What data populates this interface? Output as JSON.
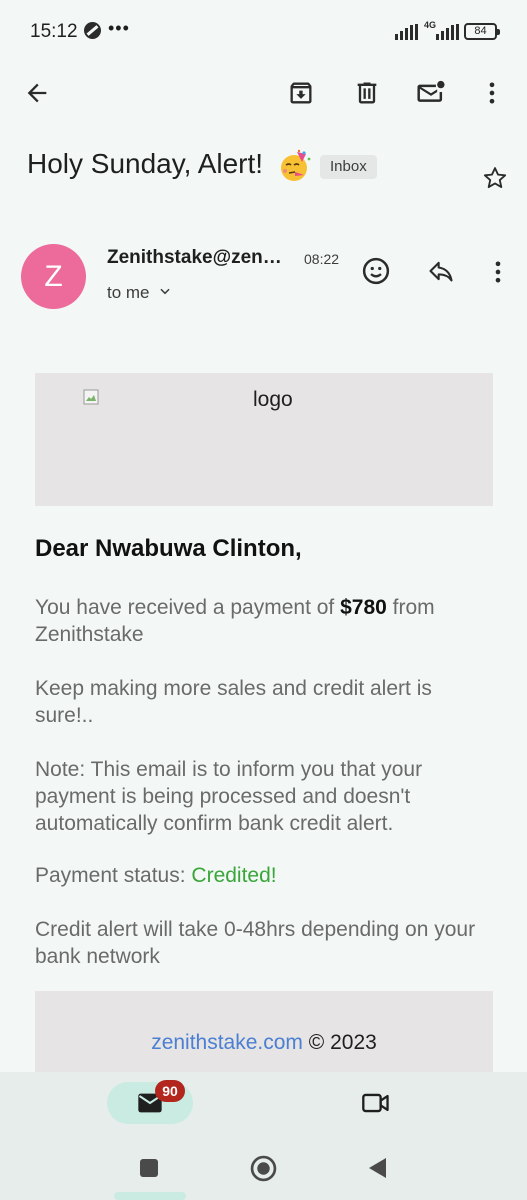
{
  "status_bar": {
    "time": "15:12",
    "more_indicator": "•••",
    "network_label": "4G",
    "battery": "84"
  },
  "toolbar": {
    "back_icon": "arrow-left-icon",
    "archive_icon": "archive-icon",
    "delete_icon": "trash-icon",
    "mark_unread_icon": "mail-unread-icon",
    "more_icon": "more-vert-icon"
  },
  "email": {
    "subject": "Holy Sunday, Alert!",
    "subject_emoji": "partying-face",
    "label_chip": "Inbox",
    "sender": {
      "avatar_letter": "Z",
      "avatar_color": "#ec6b9a",
      "name": "Zenithstake@zen…",
      "time": "08:22",
      "recipient": "to me"
    },
    "body": {
      "logo_alt": "logo",
      "greeting": "Dear Nwabuwa Clinton,",
      "payment_prefix": "You have received a payment of ",
      "payment_amount": "$780",
      "payment_suffix": " from Zenithstake",
      "encouragement": "Keep making more sales and credit alert is sure!..",
      "note": "Note: This email is to inform you that your payment is being processed and doesn't automatically confirm bank credit alert.",
      "status_label": "Payment status: ",
      "status_value": "Credited!",
      "status_color": "#3aa63a",
      "timing": "Credit alert will take 0-48hrs depending on your bank network",
      "footer_link": "zenithstake.com",
      "footer_copyright": " © 2023"
    }
  },
  "bottom_nav": {
    "mail_badge": "90",
    "mail_icon": "mail-icon",
    "meet_icon": "video-camera-icon"
  },
  "system_nav": {
    "recents_icon": "square-icon",
    "home_icon": "circle-icon",
    "back_icon": "triangle-back-icon"
  }
}
